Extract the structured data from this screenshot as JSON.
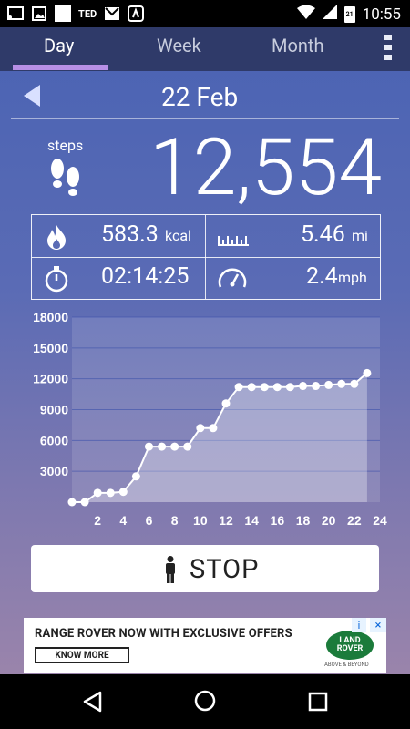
{
  "status_bar": {
    "notif_text": "TED",
    "battery": "21",
    "time": "10:55"
  },
  "tabs": [
    {
      "label": "Day"
    },
    {
      "label": "Week"
    },
    {
      "label": "Month"
    }
  ],
  "date": "22 Feb",
  "steps": {
    "label": "steps",
    "value": "12,554"
  },
  "stats": {
    "kcal": {
      "value": "583.3",
      "unit": "kcal"
    },
    "distance": {
      "value": "5.46",
      "unit": "mi"
    },
    "duration": {
      "value": "02:14:25"
    },
    "speed": {
      "value": "2.4",
      "unit": "mph"
    }
  },
  "stop_button": {
    "label": "STOP"
  },
  "ad": {
    "headline": "RANGE ROVER NOW WITH EXCLUSIVE OFFERS",
    "cta": "KNOW MORE",
    "logo_text": "LAND ROVER",
    "logo_sub": "ABOVE & BEYOND",
    "info": "i",
    "close": "×"
  },
  "colors": {
    "tab_bar": "#2f3a69",
    "tab_indicator": "#b78fe6",
    "chart_fill": "rgba(255,255,255,0.3)",
    "chart_line": "#ffffff"
  },
  "chart_data": {
    "type": "line",
    "xlabel": "",
    "ylabel": "",
    "xlim": [
      0,
      24
    ],
    "ylim": [
      0,
      18000
    ],
    "x_ticks": [
      2,
      4,
      6,
      8,
      10,
      12,
      14,
      16,
      18,
      20,
      22,
      24
    ],
    "y_ticks": [
      3000,
      6000,
      9000,
      12000,
      15000,
      18000
    ],
    "grid": true,
    "x": [
      0,
      1,
      2,
      3,
      4,
      5,
      6,
      7,
      8,
      9,
      10,
      11,
      12,
      13,
      14,
      15,
      16,
      17,
      18,
      19,
      20,
      21,
      22,
      23
    ],
    "values": [
      0,
      0,
      900,
      900,
      1000,
      2500,
      5400,
      5400,
      5400,
      5400,
      7200,
      7200,
      9600,
      11200,
      11200,
      11200,
      11200,
      11200,
      11300,
      11300,
      11400,
      11500,
      11500,
      12554
    ]
  }
}
